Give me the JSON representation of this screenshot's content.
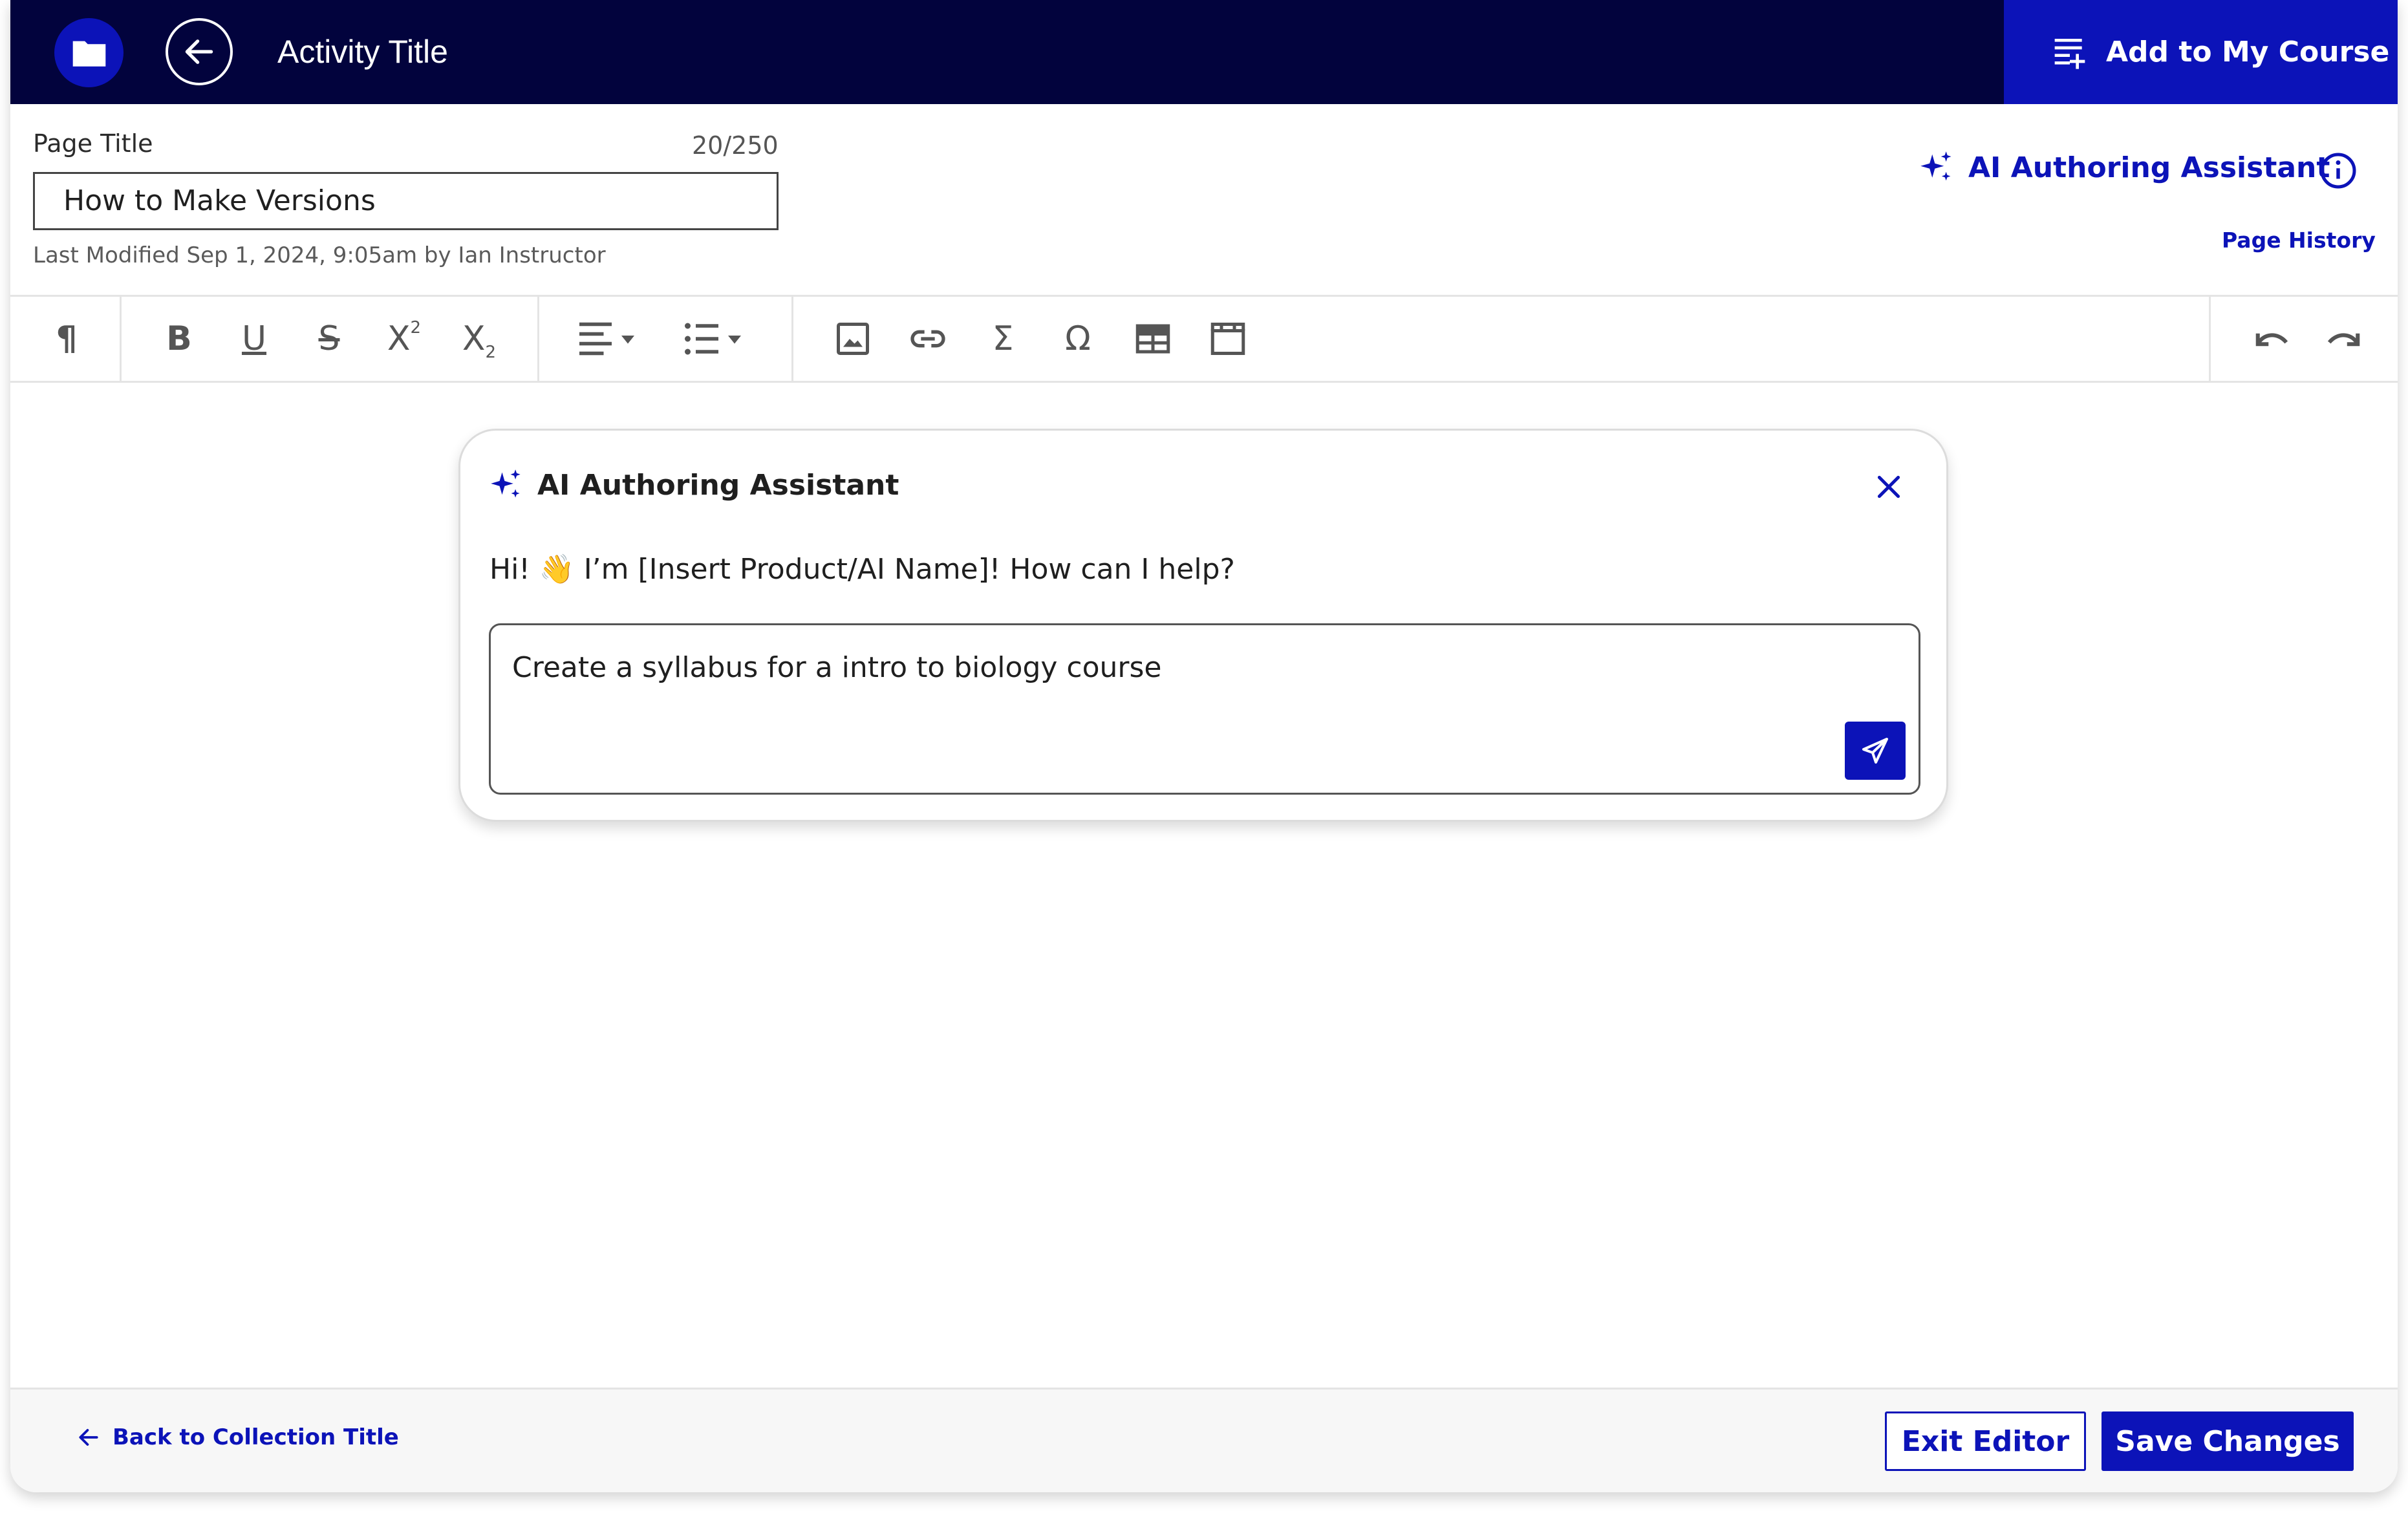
{
  "topbar": {
    "activity_title": "Activity Title",
    "add_course_label": "Add to My Course"
  },
  "header": {
    "page_title_label": "Page Title",
    "char_count": "20/250",
    "title_value": "How to Make Versions",
    "last_modified": "Last Modified Sep 1, 2024, 9:05am by Ian Instructor",
    "ai_assistant_label": "AI Authoring Assistant",
    "page_history_label": "Page History"
  },
  "toolbar": {
    "paragraph": "¶",
    "bold": "B",
    "underline": "U",
    "strikethrough": "S",
    "superscript_base": "X",
    "superscript_exp": "2",
    "subscript_base": "X",
    "subscript_sub": "2",
    "sigma": "Σ",
    "omega": "Ω",
    "icons": [
      "paragraph-icon",
      "bold-icon",
      "underline-icon",
      "strikethrough-icon",
      "superscript-icon",
      "subscript-icon",
      "align-icon",
      "list-icon",
      "image-icon",
      "link-icon",
      "sigma-icon",
      "omega-icon",
      "table-icon",
      "media-icon",
      "undo-icon",
      "redo-icon"
    ]
  },
  "assistant": {
    "title": "AI Authoring Assistant",
    "greeting": "Hi! 👋 I’m [Insert Product/AI Name]! How can I help?",
    "prompt_text": "Create a syllabus for a intro to biology course"
  },
  "footer": {
    "back_label": "Back to Collection Title",
    "exit_label": "Exit Editor",
    "save_label": "Save Changes"
  },
  "colors": {
    "navy": "#02033d",
    "brand_blue": "#0c13b8",
    "icon_gray": "#555555",
    "border_gray": "#e4e4e4"
  }
}
